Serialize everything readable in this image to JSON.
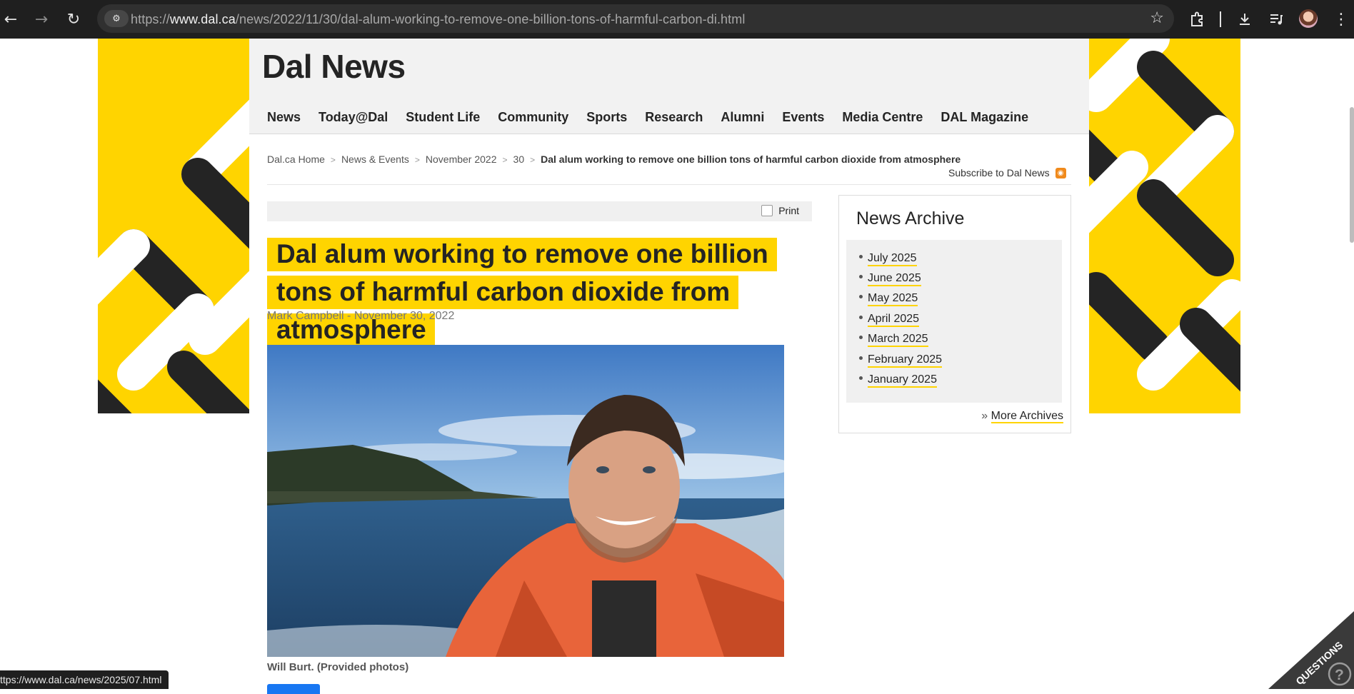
{
  "browser": {
    "url_prefix": "https://",
    "url_host": "www.dal.ca",
    "url_path": "/news/2022/11/30/dal-alum-working-to-remove-one-billion-tons-of-harmful-carbon-di.html",
    "status_url": "ttps://www.dal.ca/news/2025/07.html"
  },
  "site": {
    "title": "Dal News",
    "nav": [
      "News",
      "Today@Dal",
      "Student Life",
      "Community",
      "Sports",
      "Research",
      "Alumni",
      "Events",
      "Media Centre",
      "DAL Magazine"
    ]
  },
  "breadcrumb": {
    "items": [
      "Dal.ca Home",
      "News & Events",
      "November 2022",
      "30"
    ],
    "current": "Dal alum working to remove one billion tons of harmful carbon dioxide from atmosphere"
  },
  "subscribe_label": "Subscribe to Dal News",
  "article": {
    "print_label": "Print",
    "headline": "Dal alum working to remove one billion tons of harmful carbon dioxide from atmosphere",
    "author": "Mark Campbell",
    "byline_sep": " - ",
    "date": "November 30, 2022",
    "caption": "Will Burt. (Provided photos)"
  },
  "sidebar": {
    "archive_title": "News Archive",
    "archive_items": [
      "July 2025",
      "June 2025",
      "May 2025",
      "April 2025",
      "March 2025",
      "February 2025",
      "January 2025"
    ],
    "more_prefix": "» ",
    "more_label": "More Archives"
  },
  "widgets": {
    "questions_label": "QUESTIONS",
    "help_glyph": "?"
  },
  "colors": {
    "brand_yellow": "#ffd400",
    "toolbar_bg": "#1f1f1f"
  }
}
